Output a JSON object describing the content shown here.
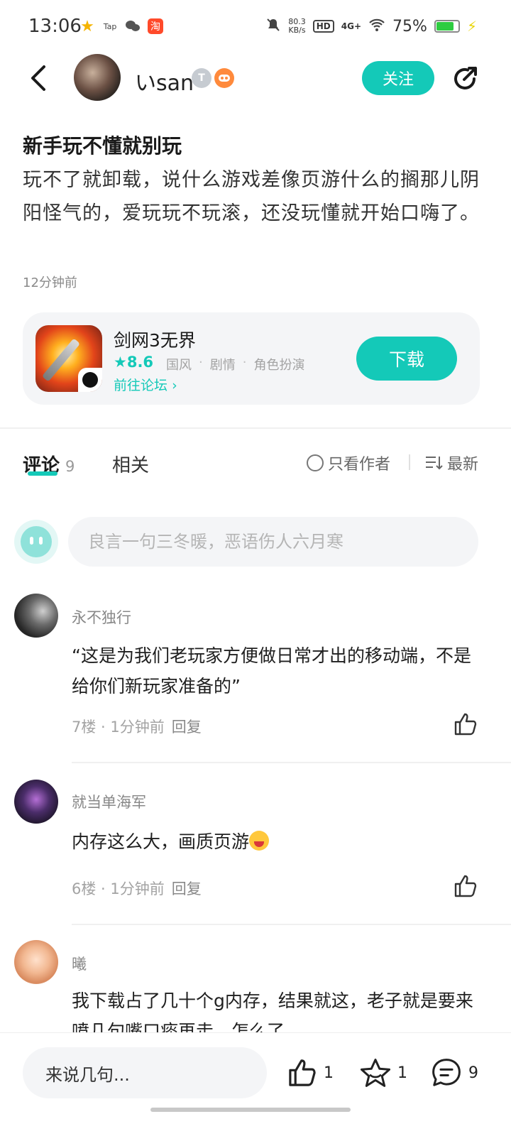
{
  "status_bar": {
    "time": "13:06",
    "net_speed_value": "80.3",
    "net_speed_unit": "KB/s",
    "hd_label": "HD",
    "network": "4G+",
    "battery": "75%",
    "taptap_label": "Tap",
    "taobao_label": "淘"
  },
  "header": {
    "username": "いsan",
    "badge_t": "T",
    "follow_label": "关注"
  },
  "post": {
    "title": "新手玩不懂就别玩",
    "body": "玩不了就卸载，说什么游戏差像页游什么的搁那儿阴阳怪气的，爱玩玩不玩滚，还没玩懂就开始口嗨了。",
    "time": "12分钟前"
  },
  "game_card": {
    "name": "剑网3无界",
    "rating": "8.6",
    "tags": [
      "国风",
      "剧情",
      "角色扮演"
    ],
    "forum_link": "前往论坛",
    "download_label": "下载"
  },
  "tabs": {
    "comments_label": "评论",
    "comments_count": "9",
    "related_label": "相关",
    "only_author_label": "只看作者",
    "sort_label": "最新"
  },
  "comment_input": {
    "placeholder": "良言一句三冬暖，恶语伤人六月寒"
  },
  "comments": [
    {
      "name": "永不独行",
      "text": "“这是为我们老玩家方便做日常才出的移动端，不是给你们新玩家准备的”",
      "floor": "7楼",
      "time": "1分钟前",
      "reply": "回复"
    },
    {
      "name": "就当单海军",
      "text": "内存这么大，画质页游",
      "floor": "6楼",
      "time": "1分钟前",
      "reply": "回复"
    },
    {
      "name": "曦",
      "text": "我下载占了几十个g内存，结果就这，老子就是要来喷几句嘴口痰再走，怎么了",
      "floor": "",
      "time": "",
      "reply": ""
    }
  ],
  "bottom_bar": {
    "input_label": "来说几句...",
    "like_count": "1",
    "favorite_count": "1",
    "comment_count": "9"
  },
  "colors": {
    "accent": "#14c9b8",
    "text_primary": "#1a1a1a",
    "text_secondary": "#888888",
    "card_bg": "#f4f5f7"
  }
}
